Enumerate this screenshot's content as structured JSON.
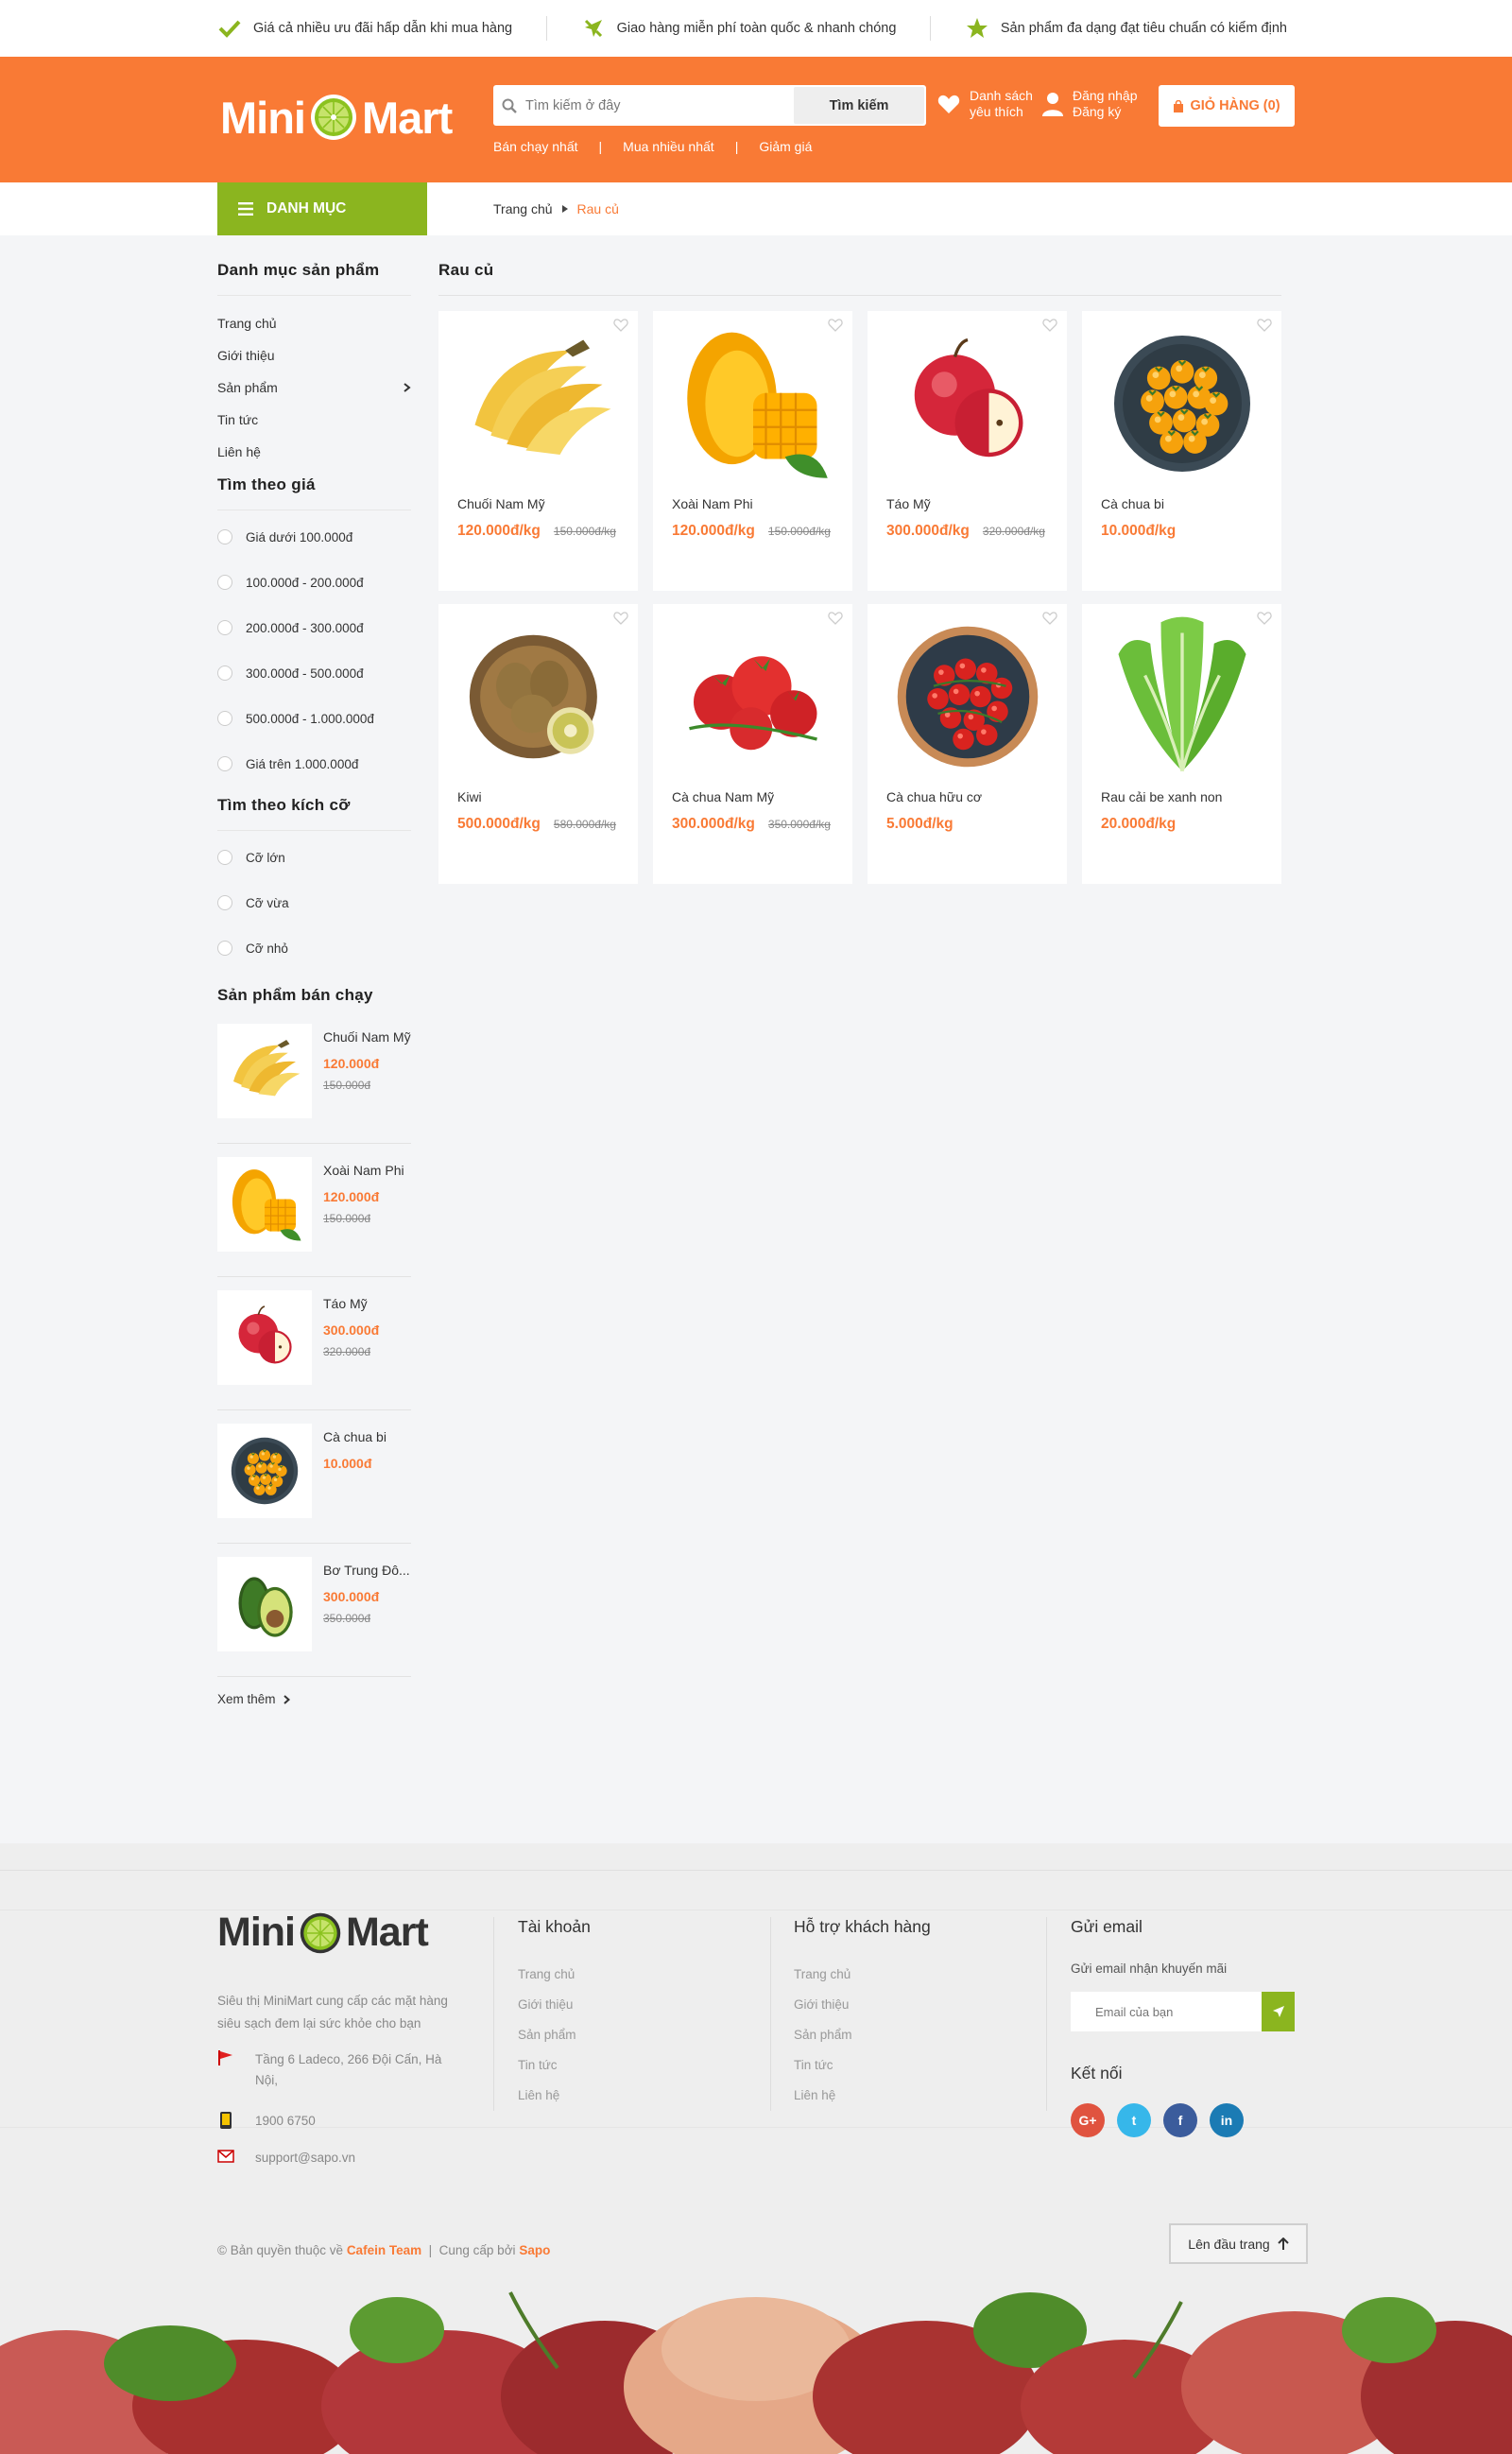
{
  "topbar": {
    "items": [
      {
        "text": "Giá cả nhiều ưu đãi hấp dẫn khi mua hàng",
        "icon": "check-icon"
      },
      {
        "text": "Giao hàng miễn phí toàn quốc & nhanh chóng",
        "icon": "plane-icon"
      },
      {
        "text": "Sản phẩm đa dạng đạt tiêu chuẩn có kiểm định",
        "icon": "star-icon"
      }
    ]
  },
  "header": {
    "logo_left": "Mini",
    "logo_right": "Mart",
    "search_placeholder": "Tìm kiếm ở đây",
    "search_button": "Tìm kiếm",
    "quick_links": [
      "Bán chạy nhất",
      "Mua nhiều nhất",
      "Giảm giá"
    ],
    "wishlist_line1": "Danh sách",
    "wishlist_line2": "yêu thích",
    "login": "Đăng nhập",
    "register": "Đăng ký",
    "cart": "GIỎ HÀNG (0)",
    "brand_color": "#f97a35",
    "accent_color": "#8bb51f"
  },
  "nav": {
    "category_button": "DANH MỤC",
    "breadcrumb": [
      "Trang chủ",
      "Rau củ"
    ]
  },
  "sidebar": {
    "categories_title": "Danh mục sản phẩm",
    "categories": [
      "Trang chủ",
      "Giới thiệu",
      "Sản phẩm",
      "Tin tức",
      "Liên hệ"
    ],
    "price_title": "Tìm theo giá",
    "prices": [
      "Giá dưới 100.000đ",
      "100.000đ - 200.000đ",
      "200.000đ - 300.000đ",
      "300.000đ - 500.000đ",
      "500.000đ - 1.000.000đ",
      "Giá trên 1.000.000đ"
    ],
    "size_title": "Tìm theo kích cỡ",
    "sizes": [
      "Cỡ lớn",
      "Cỡ vừa",
      "Cỡ nhỏ"
    ],
    "bestseller_title": "Sản phẩm bán chạy",
    "bestsellers": [
      {
        "name": "Chuối Nam Mỹ",
        "price": "120.000đ",
        "old": "150.000đ",
        "img": "banana"
      },
      {
        "name": "Xoài Nam Phi",
        "price": "120.000đ",
        "old": "150.000đ",
        "img": "mango"
      },
      {
        "name": "Táo Mỹ",
        "price": "300.000đ",
        "old": "320.000đ",
        "img": "apple"
      },
      {
        "name": "Cà chua bi",
        "price": "10.000đ",
        "old": "",
        "img": "cherry-tomato"
      },
      {
        "name": "Bơ Trung Đô...",
        "price": "300.000đ",
        "old": "350.000đ",
        "img": "avocado"
      }
    ],
    "more": "Xem thêm"
  },
  "content": {
    "title": "Rau củ",
    "products": [
      {
        "name": "Chuối Nam Mỹ",
        "price": "120.000đ/kg",
        "old": "150.000đ/kg",
        "img": "banana"
      },
      {
        "name": "Xoài Nam Phi",
        "price": "120.000đ/kg",
        "old": "150.000đ/kg",
        "img": "mango"
      },
      {
        "name": "Táo Mỹ",
        "price": "300.000đ/kg",
        "old": "320.000đ/kg",
        "img": "apple"
      },
      {
        "name": "Cà chua bi",
        "price": "10.000đ/kg",
        "old": "",
        "img": "cherry-tomato"
      },
      {
        "name": "Kiwi",
        "price": "500.000đ/kg",
        "old": "580.000đ/kg",
        "img": "kiwi"
      },
      {
        "name": "Cà chua Nam Mỹ",
        "price": "300.000đ/kg",
        "old": "350.000đ/kg",
        "img": "tomato"
      },
      {
        "name": "Cà chua hữu cơ",
        "price": "5.000đ/kg",
        "old": "",
        "img": "organic-tomato"
      },
      {
        "name": "Rau cải be xanh non",
        "price": "20.000đ/kg",
        "old": "",
        "img": "greens"
      }
    ]
  },
  "footer": {
    "logo_left": "Mini",
    "logo_right": "Mart",
    "description": "Siêu thị MiniMart cung cấp các mặt hàng siêu sạch đem lại sức khỏe cho bạn",
    "address": "Tầng 6 Ladeco, 266 Đội Cấn, Hà Nội,",
    "phone": "1900 6750",
    "email": "support@sapo.vn",
    "account_title": "Tài khoản",
    "account_links": [
      "Trang chủ",
      "Giới thiệu",
      "Sản phẩm",
      "Tin tức",
      "Liên hệ"
    ],
    "support_title": "Hỗ trợ khách hàng",
    "support_links": [
      "Trang chủ",
      "Giới thiệu",
      "Sản phẩm",
      "Tin tức",
      "Liên hệ"
    ],
    "email_title": "Gửi email",
    "email_sub": "Gửi email nhận khuyến mãi",
    "email_placeholder": "Email của bạn",
    "connect_title": "Kết nối",
    "social": [
      {
        "label": "G+",
        "color": "#e0533f",
        "icon": "google-plus-icon"
      },
      {
        "label": "t",
        "color": "#36b7ea",
        "icon": "twitter-icon"
      },
      {
        "label": "f",
        "color": "#3b5c9c",
        "icon": "facebook-icon"
      },
      {
        "label": "in",
        "color": "#1b7bb4",
        "icon": "linkedin-icon"
      }
    ],
    "copyright_prefix": "© Bản quyền thuộc về",
    "copyright_team": "Cafein Team",
    "copyright_mid": "Cung cấp bởi",
    "copyright_sapo": "Sapo",
    "to_top": "Lên đầu trang"
  }
}
